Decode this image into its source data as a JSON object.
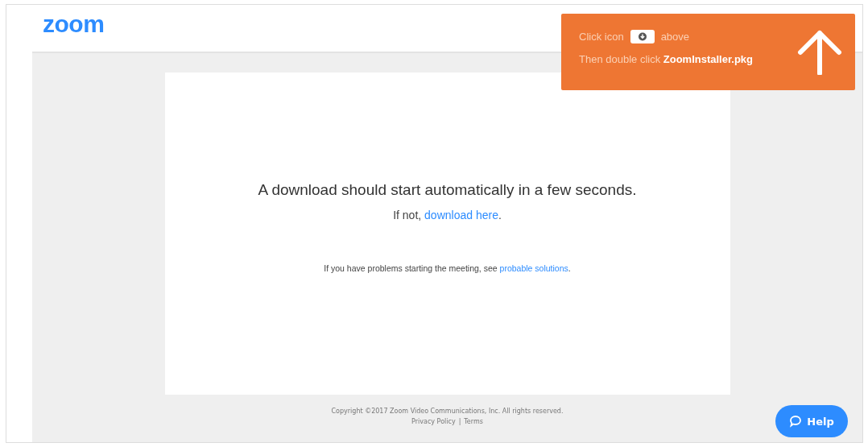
{
  "logo": "zoom",
  "message": {
    "headline": "A download should start automatically in a few seconds.",
    "fallback": {
      "before": "If not, ",
      "link": "download here",
      "after": "."
    },
    "problems": {
      "before": "If you have problems starting the meeting, see ",
      "link": "probable solutions",
      "after": "."
    }
  },
  "footer": {
    "copyright": "Copyright ©2017 Zoom Video Communications, Inc. All rights reserved.",
    "links": [
      "Privacy Policy",
      "Terms"
    ],
    "separator": "|"
  },
  "banner": {
    "line1_before": "Click icon",
    "line1_after": "above",
    "line2": "Then double click **ZoomInstaller.pkg**"
  },
  "help_button": {
    "label": "Help"
  }
}
